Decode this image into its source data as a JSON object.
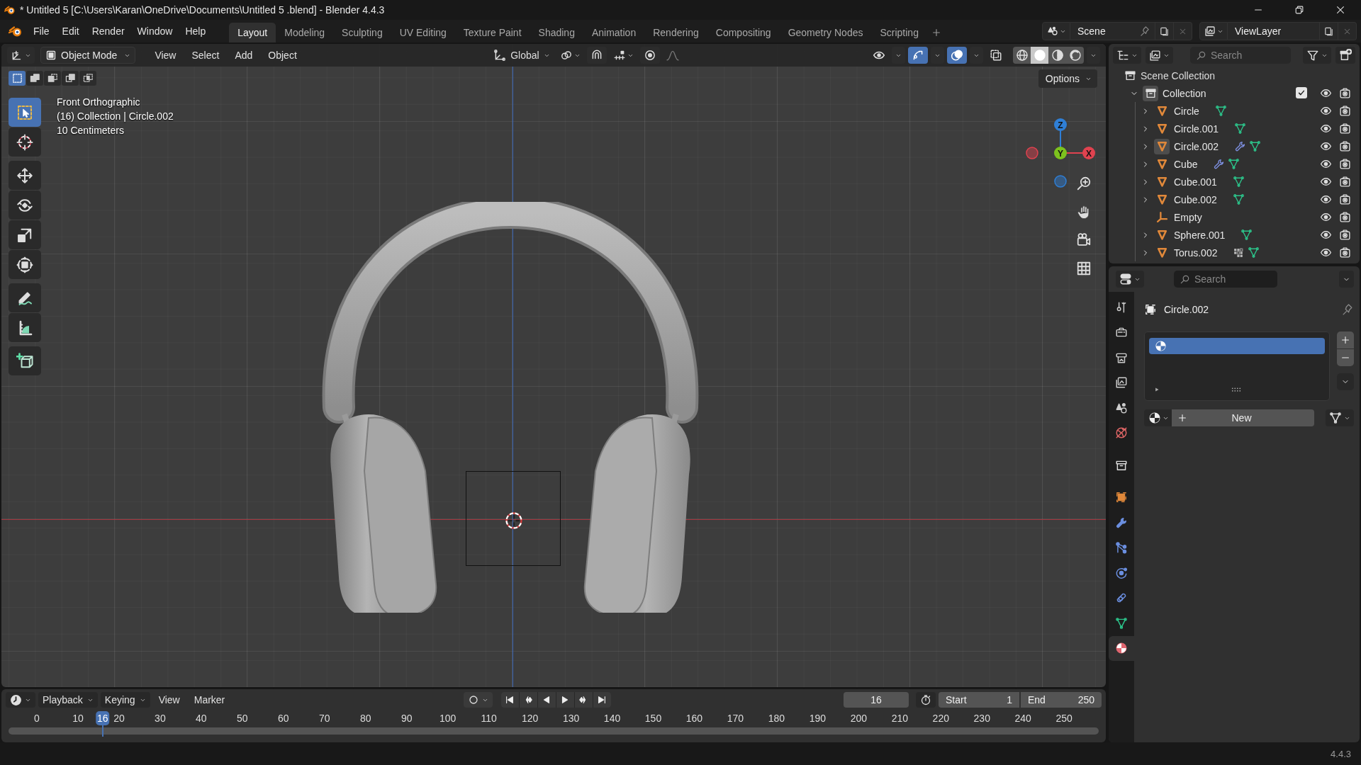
{
  "window": {
    "title": "* Untitled 5  [C:\\Users\\Karan\\OneDrive\\Documents\\Untitled 5 .blend] - Blender 4.4.3"
  },
  "menu": [
    "File",
    "Edit",
    "Render",
    "Window",
    "Help"
  ],
  "workspaces": [
    {
      "label": "Layout",
      "selected": true
    },
    {
      "label": "Modeling",
      "selected": false
    },
    {
      "label": "Sculpting",
      "selected": false
    },
    {
      "label": "UV Editing",
      "selected": false
    },
    {
      "label": "Texture Paint",
      "selected": false
    },
    {
      "label": "Shading",
      "selected": false
    },
    {
      "label": "Animation",
      "selected": false
    },
    {
      "label": "Rendering",
      "selected": false
    },
    {
      "label": "Compositing",
      "selected": false
    },
    {
      "label": "Geometry Nodes",
      "selected": false
    },
    {
      "label": "Scripting",
      "selected": false
    }
  ],
  "scene": "Scene",
  "view_layer": "ViewLayer",
  "viewport": {
    "mode": "Object Mode",
    "menus": [
      "View",
      "Select",
      "Add",
      "Object"
    ],
    "orientation": "Global",
    "toggles": [
      {
        "kind": "visibility",
        "on": false
      },
      {
        "kind": "gizmo",
        "on": true
      },
      {
        "kind": "overlays",
        "on": true
      },
      {
        "kind": "xray",
        "on": false
      }
    ],
    "shading": [
      {
        "kind": "wireframe",
        "selected": false
      },
      {
        "kind": "solid",
        "selected": true
      },
      {
        "kind": "material",
        "selected": false
      },
      {
        "kind": "rendered",
        "selected": false
      }
    ],
    "select_modes": [
      {
        "kind": "new",
        "selected": true
      },
      {
        "kind": "extend",
        "selected": false
      },
      {
        "kind": "subtract",
        "selected": false
      },
      {
        "kind": "invert",
        "selected": false
      },
      {
        "kind": "intersect",
        "selected": false
      }
    ],
    "options": "Options",
    "info": [
      "Front Orthographic",
      "(16) Collection | Circle.002",
      "10 Centimeters"
    ],
    "tools": [
      {
        "kind": "select_box",
        "selected": true
      },
      {
        "kind": "cursor",
        "selected": false
      },
      {
        "kind": "move",
        "selected": false
      },
      {
        "kind": "rotate",
        "selected": false
      },
      {
        "kind": "scale",
        "selected": false
      },
      {
        "kind": "transform",
        "selected": false
      },
      {
        "kind": "annotate",
        "selected": false
      },
      {
        "kind": "measure",
        "selected": false
      },
      {
        "kind": "add_cube",
        "selected": false
      }
    ],
    "axes": [
      {
        "kind": "z",
        "label": "Z",
        "color": "#2f7fd6"
      },
      {
        "kind": "y",
        "label": "Y",
        "color": "#7dc21e"
      },
      {
        "kind": "x",
        "label": "X",
        "color": "#e0424f"
      }
    ]
  },
  "outliner": {
    "search_placeholder": "Search",
    "root": "Scene Collection",
    "collection": {
      "name": "Collection",
      "expanded": true,
      "checked": true,
      "children": [
        {
          "name": "Circle",
          "kind": "mesh",
          "selected": false,
          "expandable": true,
          "modifiers": false,
          "particles": false
        },
        {
          "name": "Circle.001",
          "kind": "mesh",
          "selected": false,
          "expandable": true,
          "modifiers": false,
          "particles": false
        },
        {
          "name": "Circle.002",
          "kind": "mesh",
          "selected": true,
          "expandable": true,
          "modifiers": true,
          "particles": false
        },
        {
          "name": "Cube",
          "kind": "mesh",
          "selected": false,
          "expandable": true,
          "modifiers": true,
          "particles": false
        },
        {
          "name": "Cube.001",
          "kind": "mesh",
          "selected": false,
          "expandable": true,
          "modifiers": false,
          "particles": false
        },
        {
          "name": "Cube.002",
          "kind": "mesh",
          "selected": false,
          "expandable": true,
          "modifiers": false,
          "particles": false
        },
        {
          "name": "Empty",
          "kind": "empty",
          "selected": false,
          "expandable": false,
          "modifiers": false,
          "particles": false
        },
        {
          "name": "Sphere.001",
          "kind": "mesh",
          "selected": false,
          "expandable": true,
          "modifiers": false,
          "particles": false
        },
        {
          "name": "Torus.002",
          "kind": "mesh",
          "selected": false,
          "expandable": true,
          "modifiers": false,
          "particles": true
        }
      ]
    }
  },
  "properties": {
    "search_placeholder": "Search",
    "tabs": [
      {
        "kind": "tool",
        "selected": false
      },
      {
        "kind": "render",
        "selected": false
      },
      {
        "kind": "output",
        "selected": false
      },
      {
        "kind": "view_layer",
        "selected": false
      },
      {
        "kind": "scene",
        "selected": false
      },
      {
        "kind": "world",
        "selected": false
      },
      {
        "kind": "collection",
        "selected": false
      },
      {
        "kind": "object",
        "selected": false
      },
      {
        "kind": "modifiers",
        "selected": false
      },
      {
        "kind": "particles",
        "selected": false
      },
      {
        "kind": "physics",
        "selected": false
      },
      {
        "kind": "constraints",
        "selected": false
      },
      {
        "kind": "data",
        "selected": false
      },
      {
        "kind": "material",
        "selected": true
      }
    ],
    "object": "Circle.002",
    "slots": [
      {
        "selected": true
      }
    ],
    "new_button": "New"
  },
  "timeline": {
    "menus": [
      "Playback",
      "Keying",
      "View",
      "Marker"
    ],
    "auto_keying": false,
    "current_frame": "16",
    "start_label": "Start",
    "start": "1",
    "end_label": "End",
    "end": "250",
    "ruler": [
      "0",
      "10",
      "20",
      "30",
      "40",
      "50",
      "60",
      "70",
      "80",
      "90",
      "100",
      "110",
      "120",
      "130",
      "140",
      "150",
      "160",
      "170",
      "180",
      "190",
      "200",
      "210",
      "220",
      "230",
      "240",
      "250"
    ],
    "playhead": "16"
  },
  "status_bar": {
    "version": "4.4.3"
  }
}
